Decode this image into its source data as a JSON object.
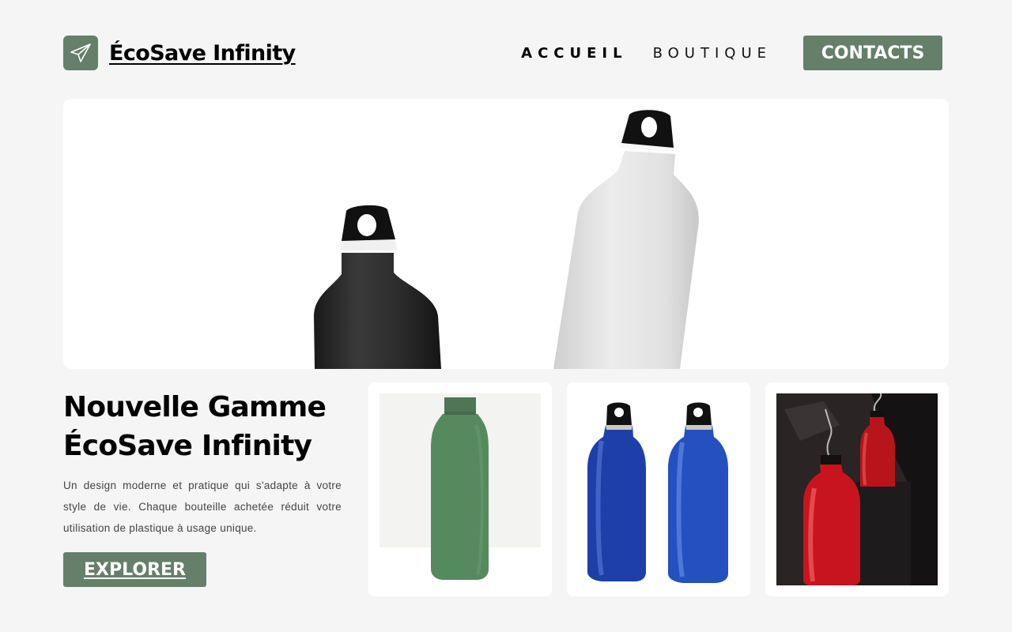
{
  "header": {
    "brand": "ÉcoSave Infinity",
    "logo_icon": "paper-plane-icon",
    "nav": {
      "home": "ACCUEIL",
      "shop": "BOUTIQUE",
      "contacts": "CONTACTS"
    }
  },
  "hero": {
    "image": "black-and-white-bottles-photo"
  },
  "intro": {
    "title_line1": "Nouvelle Gamme",
    "title_line2": "ÉcoSave Infinity",
    "description": "Un design moderne et pratique qui s'adapte à votre style de vie. Chaque bouteille achetée réduit votre utilisation de plastique à usage unique.",
    "cta": "EXPLORER"
  },
  "products": [
    {
      "image": "green-bottle-photo"
    },
    {
      "image": "blue-bottles-photo"
    },
    {
      "image": "red-bottles-photo"
    }
  ],
  "colors": {
    "accent": "#657f6a",
    "background": "#f5f5f5",
    "card": "#ffffff"
  }
}
